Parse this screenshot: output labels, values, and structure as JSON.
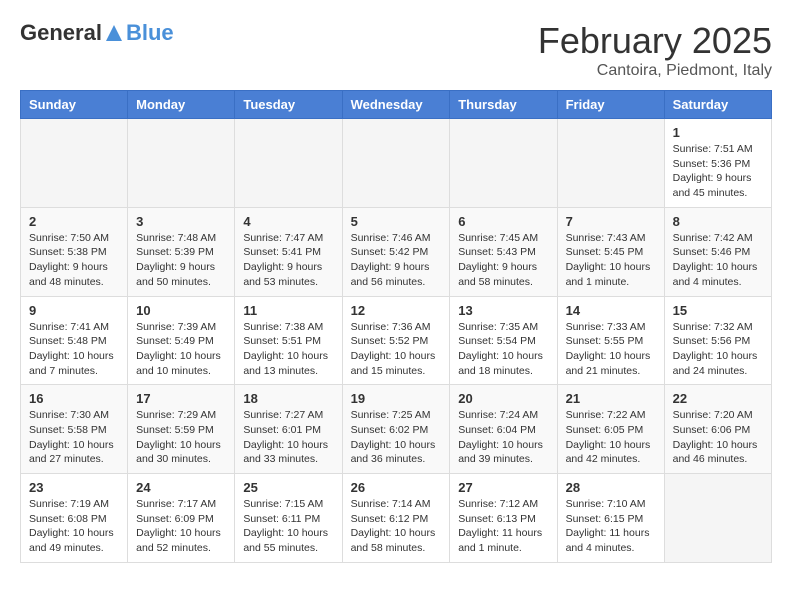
{
  "header": {
    "logo_general": "General",
    "logo_blue": "Blue",
    "month_title": "February 2025",
    "subtitle": "Cantoira, Piedmont, Italy"
  },
  "days_of_week": [
    "Sunday",
    "Monday",
    "Tuesday",
    "Wednesday",
    "Thursday",
    "Friday",
    "Saturday"
  ],
  "weeks": [
    {
      "days": [
        {
          "num": "",
          "info": ""
        },
        {
          "num": "",
          "info": ""
        },
        {
          "num": "",
          "info": ""
        },
        {
          "num": "",
          "info": ""
        },
        {
          "num": "",
          "info": ""
        },
        {
          "num": "",
          "info": ""
        },
        {
          "num": "1",
          "info": "Sunrise: 7:51 AM\nSunset: 5:36 PM\nDaylight: 9 hours and 45 minutes."
        }
      ]
    },
    {
      "days": [
        {
          "num": "2",
          "info": "Sunrise: 7:50 AM\nSunset: 5:38 PM\nDaylight: 9 hours and 48 minutes."
        },
        {
          "num": "3",
          "info": "Sunrise: 7:48 AM\nSunset: 5:39 PM\nDaylight: 9 hours and 50 minutes."
        },
        {
          "num": "4",
          "info": "Sunrise: 7:47 AM\nSunset: 5:41 PM\nDaylight: 9 hours and 53 minutes."
        },
        {
          "num": "5",
          "info": "Sunrise: 7:46 AM\nSunset: 5:42 PM\nDaylight: 9 hours and 56 minutes."
        },
        {
          "num": "6",
          "info": "Sunrise: 7:45 AM\nSunset: 5:43 PM\nDaylight: 9 hours and 58 minutes."
        },
        {
          "num": "7",
          "info": "Sunrise: 7:43 AM\nSunset: 5:45 PM\nDaylight: 10 hours and 1 minute."
        },
        {
          "num": "8",
          "info": "Sunrise: 7:42 AM\nSunset: 5:46 PM\nDaylight: 10 hours and 4 minutes."
        }
      ]
    },
    {
      "days": [
        {
          "num": "9",
          "info": "Sunrise: 7:41 AM\nSunset: 5:48 PM\nDaylight: 10 hours and 7 minutes."
        },
        {
          "num": "10",
          "info": "Sunrise: 7:39 AM\nSunset: 5:49 PM\nDaylight: 10 hours and 10 minutes."
        },
        {
          "num": "11",
          "info": "Sunrise: 7:38 AM\nSunset: 5:51 PM\nDaylight: 10 hours and 13 minutes."
        },
        {
          "num": "12",
          "info": "Sunrise: 7:36 AM\nSunset: 5:52 PM\nDaylight: 10 hours and 15 minutes."
        },
        {
          "num": "13",
          "info": "Sunrise: 7:35 AM\nSunset: 5:54 PM\nDaylight: 10 hours and 18 minutes."
        },
        {
          "num": "14",
          "info": "Sunrise: 7:33 AM\nSunset: 5:55 PM\nDaylight: 10 hours and 21 minutes."
        },
        {
          "num": "15",
          "info": "Sunrise: 7:32 AM\nSunset: 5:56 PM\nDaylight: 10 hours and 24 minutes."
        }
      ]
    },
    {
      "days": [
        {
          "num": "16",
          "info": "Sunrise: 7:30 AM\nSunset: 5:58 PM\nDaylight: 10 hours and 27 minutes."
        },
        {
          "num": "17",
          "info": "Sunrise: 7:29 AM\nSunset: 5:59 PM\nDaylight: 10 hours and 30 minutes."
        },
        {
          "num": "18",
          "info": "Sunrise: 7:27 AM\nSunset: 6:01 PM\nDaylight: 10 hours and 33 minutes."
        },
        {
          "num": "19",
          "info": "Sunrise: 7:25 AM\nSunset: 6:02 PM\nDaylight: 10 hours and 36 minutes."
        },
        {
          "num": "20",
          "info": "Sunrise: 7:24 AM\nSunset: 6:04 PM\nDaylight: 10 hours and 39 minutes."
        },
        {
          "num": "21",
          "info": "Sunrise: 7:22 AM\nSunset: 6:05 PM\nDaylight: 10 hours and 42 minutes."
        },
        {
          "num": "22",
          "info": "Sunrise: 7:20 AM\nSunset: 6:06 PM\nDaylight: 10 hours and 46 minutes."
        }
      ]
    },
    {
      "days": [
        {
          "num": "23",
          "info": "Sunrise: 7:19 AM\nSunset: 6:08 PM\nDaylight: 10 hours and 49 minutes."
        },
        {
          "num": "24",
          "info": "Sunrise: 7:17 AM\nSunset: 6:09 PM\nDaylight: 10 hours and 52 minutes."
        },
        {
          "num": "25",
          "info": "Sunrise: 7:15 AM\nSunset: 6:11 PM\nDaylight: 10 hours and 55 minutes."
        },
        {
          "num": "26",
          "info": "Sunrise: 7:14 AM\nSunset: 6:12 PM\nDaylight: 10 hours and 58 minutes."
        },
        {
          "num": "27",
          "info": "Sunrise: 7:12 AM\nSunset: 6:13 PM\nDaylight: 11 hours and 1 minute."
        },
        {
          "num": "28",
          "info": "Sunrise: 7:10 AM\nSunset: 6:15 PM\nDaylight: 11 hours and 4 minutes."
        },
        {
          "num": "",
          "info": ""
        }
      ]
    }
  ]
}
